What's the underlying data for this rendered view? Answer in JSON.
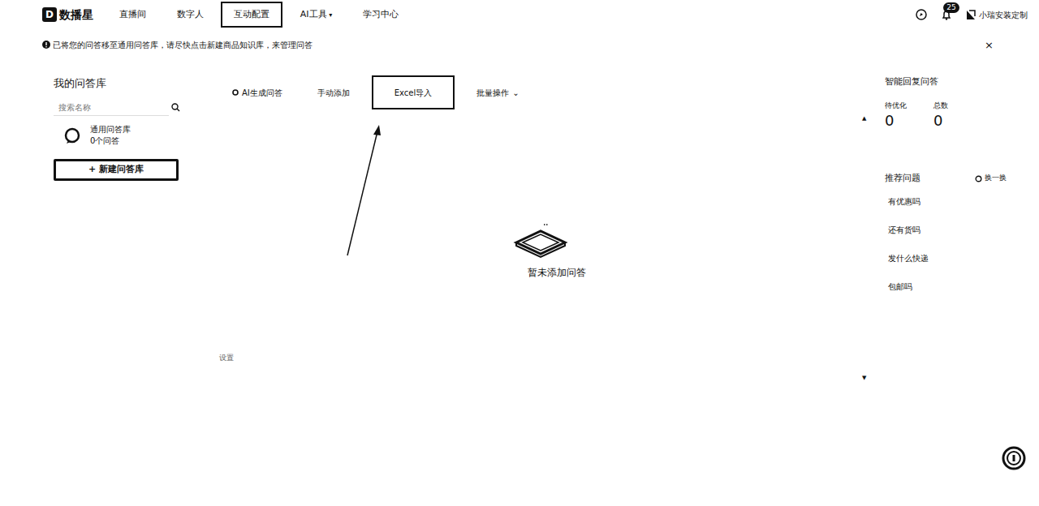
{
  "logo": {
    "mark": "D",
    "name": "数播星"
  },
  "nav": [
    {
      "label": "直播间",
      "selected": false
    },
    {
      "label": "数字人",
      "selected": false
    },
    {
      "label": "互动配置",
      "selected": true
    },
    {
      "label": "AI工具",
      "selected": false,
      "caret": "▾"
    },
    {
      "label": "学习中心",
      "selected": false
    }
  ],
  "header": {
    "notifications": "25",
    "user": "小瑞安装定制"
  },
  "notice": {
    "text": "已将您的问答移至通用问答库，请尽快点击新建商品知识库，来管理问答",
    "close": "×"
  },
  "library": {
    "title": "我的问答库",
    "search": {
      "placeholder": "搜索名称"
    },
    "items": [
      {
        "name": "通用问答库",
        "count": "0个问答",
        "selected": true
      }
    ],
    "new_button": "+ 新建问答库"
  },
  "toolbar": [
    {
      "label": "AI生成问答",
      "selected": false
    },
    {
      "label": "手动添加",
      "selected": false
    },
    {
      "label": "Excel导入",
      "selected": true
    },
    {
      "label": "批量操作",
      "selected": false,
      "caret": "⌄"
    }
  ],
  "empty": {
    "text": "暂未添加问答"
  },
  "footer_text": "设置",
  "scroll": {
    "up": "▲",
    "down": "▼"
  },
  "stats": {
    "title": "智能回复问答",
    "items": [
      {
        "label": "待优化",
        "value": "0"
      },
      {
        "label": "总数",
        "value": "0"
      }
    ]
  },
  "recommend": {
    "title": "推荐问题",
    "refresh": "换一换",
    "items": [
      "有优惠吗",
      "还有货吗",
      "发什么快递",
      "包邮吗"
    ]
  }
}
